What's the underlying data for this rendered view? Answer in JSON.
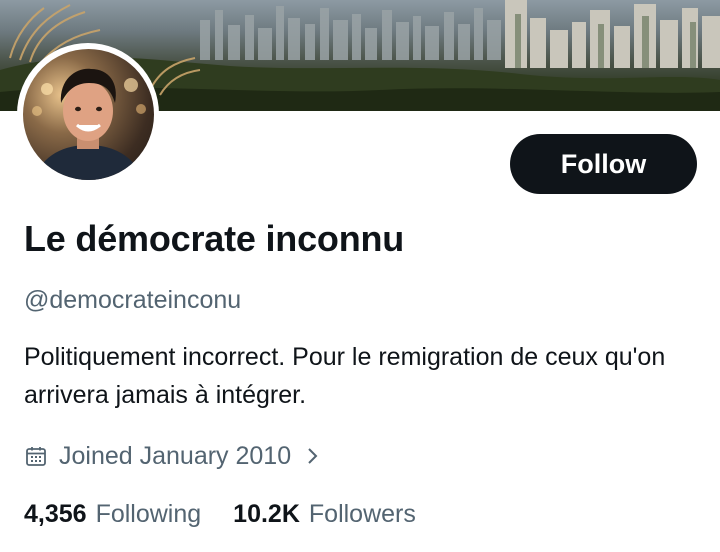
{
  "profile": {
    "display_name": "Le démocrate inconnu",
    "handle": "@democrateinconu",
    "bio": "Politiquement incorrect. Pour le remigration de ceux qu'on arrivera jamais à intégrer.",
    "joined": "Joined January 2010"
  },
  "actions": {
    "follow_label": "Follow"
  },
  "stats": {
    "following_count": "4,356",
    "following_label": "Following",
    "followers_count": "10.2K",
    "followers_label": "Followers"
  },
  "colors": {
    "primary_text": "#0f1419",
    "secondary_text": "#536471",
    "button_bg": "#0f1419",
    "button_text": "#ffffff"
  },
  "icons": {
    "joined": "calendar-icon",
    "more": "chevron-right-icon"
  }
}
